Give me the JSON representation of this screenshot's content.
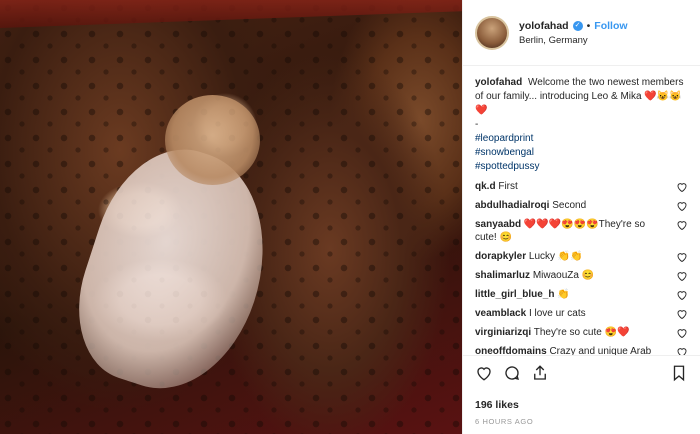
{
  "header": {
    "username": "yolofahad",
    "follow_label": "Follow",
    "separator": "•",
    "location": "Berlin, Germany"
  },
  "caption": {
    "username": "yolofahad",
    "line1": "Welcome the two newest members of our family... introducing Leo & Mika",
    "line1_emoji": "❤️😺😺❤️",
    "dash": "-",
    "tags": [
      "#leopardprint",
      "#snowbengal",
      "#spottedpussy"
    ]
  },
  "comments": [
    {
      "user": "qk.d",
      "text": "First"
    },
    {
      "user": "abdulhadialroqi",
      "text": "Second"
    },
    {
      "user": "sanyaabd",
      "text": "❤️❤️❤️😍😍😍They're so cute! 😊"
    },
    {
      "user": "dorapkyler",
      "text": "Lucky 👏👏"
    },
    {
      "user": "shalimarluz",
      "text": "MiwaouZa 😊"
    },
    {
      "user": "little_girl_blue_h",
      "text": "👏"
    },
    {
      "user": "veamblack",
      "text": "I love ur cats"
    },
    {
      "user": "virginiarizqi",
      "text": "They're so cute 😍❤️"
    },
    {
      "user": "oneoffdomains",
      "text": "Crazy and unique Arab domain names... contact us for further"
    }
  ],
  "likes": "196 likes",
  "timestamp": "6 HOURS AGO",
  "colors": {
    "link": "#3897f0",
    "hashtag": "#003569",
    "muted": "#999999"
  },
  "icons": [
    "verified-badge-icon",
    "heart-icon",
    "comment-icon",
    "share-icon",
    "bookmark-icon"
  ]
}
